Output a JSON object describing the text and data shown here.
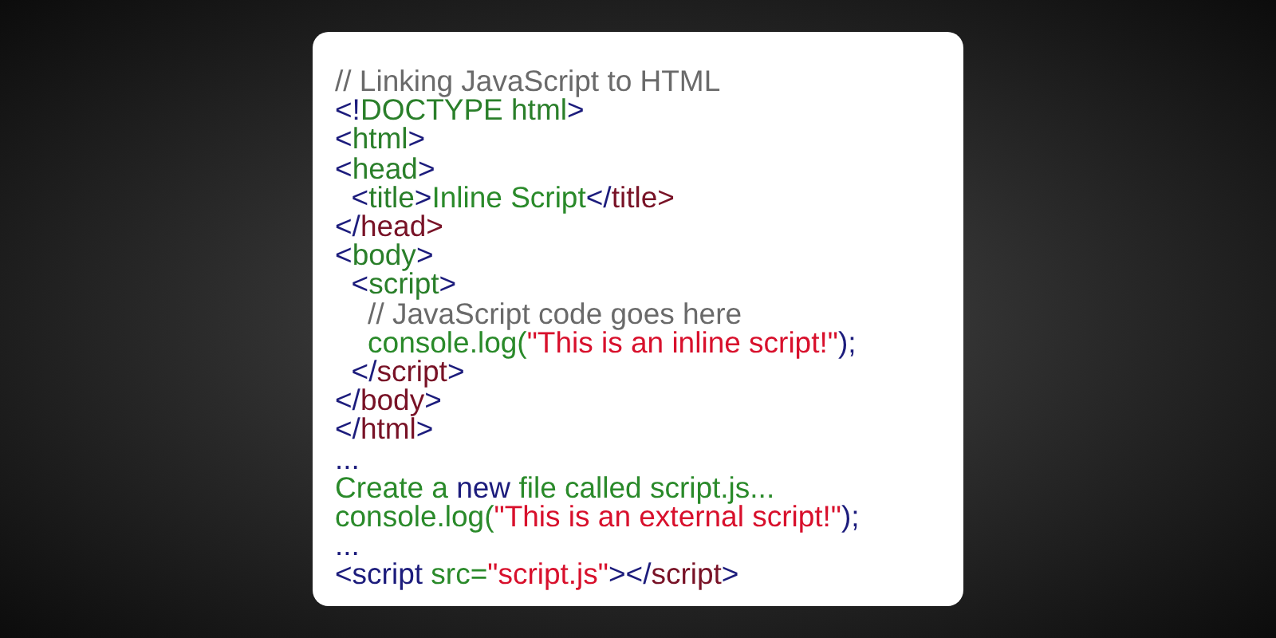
{
  "code_lines": [
    [
      {
        "kind": "comment",
        "text": "// Linking JavaScript to HTML"
      }
    ],
    [
      {
        "kind": "punct",
        "text": "<!"
      },
      {
        "kind": "tag",
        "text": "DOCTYPE html"
      },
      {
        "kind": "punct",
        "text": ">"
      }
    ],
    [
      {
        "kind": "punct",
        "text": "<"
      },
      {
        "kind": "tag",
        "text": "html"
      },
      {
        "kind": "punct",
        "text": ">"
      }
    ],
    [
      {
        "kind": "punct",
        "text": "<"
      },
      {
        "kind": "tag",
        "text": "head"
      },
      {
        "kind": "punct",
        "text": ">"
      }
    ],
    [
      {
        "kind": "punct",
        "text": "  <"
      },
      {
        "kind": "tag",
        "text": "title"
      },
      {
        "kind": "punct",
        "text": ">"
      },
      {
        "kind": "text",
        "text": "Inline Script"
      },
      {
        "kind": "punct",
        "text": "</"
      },
      {
        "kind": "endtag",
        "text": "title>"
      }
    ],
    [
      {
        "kind": "punct",
        "text": "</"
      },
      {
        "kind": "endtag",
        "text": "head>"
      }
    ],
    [
      {
        "kind": "punct",
        "text": "<"
      },
      {
        "kind": "tag",
        "text": "body"
      },
      {
        "kind": "punct",
        "text": ">"
      }
    ],
    [
      {
        "kind": "punct",
        "text": "  <"
      },
      {
        "kind": "tag",
        "text": "script"
      },
      {
        "kind": "punct",
        "text": ">"
      }
    ],
    [
      {
        "kind": "comment",
        "text": "    // JavaScript code goes here"
      }
    ],
    [
      {
        "kind": "text",
        "text": "    console.log("
      },
      {
        "kind": "string",
        "text": "\"This is an inline script!\""
      },
      {
        "kind": "punct",
        "text": ");"
      }
    ],
    [
      {
        "kind": "punct",
        "text": "  </"
      },
      {
        "kind": "endtag",
        "text": "script"
      },
      {
        "kind": "punct",
        "text": ">"
      }
    ],
    [
      {
        "kind": "punct",
        "text": "</"
      },
      {
        "kind": "endtag",
        "text": "body"
      },
      {
        "kind": "punct",
        "text": ">"
      }
    ],
    [
      {
        "kind": "punct",
        "text": "</"
      },
      {
        "kind": "endtag",
        "text": "html"
      },
      {
        "kind": "punct",
        "text": ">"
      }
    ],
    [
      {
        "kind": "punct",
        "text": "..."
      }
    ],
    [
      {
        "kind": "text",
        "text": "Create a "
      },
      {
        "kind": "punct",
        "text": "new"
      },
      {
        "kind": "text",
        "text": " file called script.js..."
      }
    ],
    [
      {
        "kind": "text",
        "text": "console.log("
      },
      {
        "kind": "string",
        "text": "\"This is an external script!\""
      },
      {
        "kind": "punct",
        "text": ");"
      }
    ],
    [
      {
        "kind": "punct",
        "text": "..."
      }
    ],
    [
      {
        "kind": "punct",
        "text": "<script "
      },
      {
        "kind": "text",
        "text": "src="
      },
      {
        "kind": "string",
        "text": "\"script.js\""
      },
      {
        "kind": "punct",
        "text": "></"
      },
      {
        "kind": "endtag",
        "text": "script"
      },
      {
        "kind": "punct",
        "text": ">"
      }
    ]
  ]
}
